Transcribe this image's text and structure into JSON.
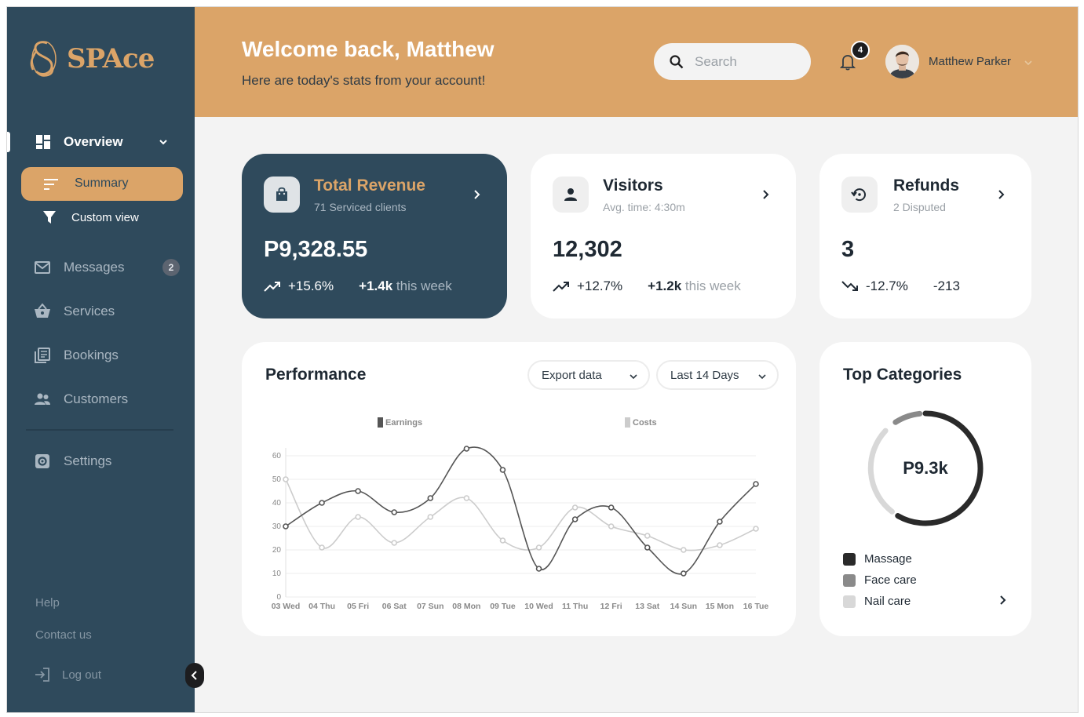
{
  "brand": {
    "name": "SPAce",
    "accent": "#dba468",
    "sidebar_bg": "#2f4a5c"
  },
  "sidebar": {
    "overview": {
      "label": "Overview",
      "icon": "dashboard-icon"
    },
    "summary": {
      "label": "Summary",
      "icon": "sort-lines-icon"
    },
    "custom_view": {
      "label": "Custom view",
      "icon": "filter-icon"
    },
    "items": [
      {
        "label": "Messages",
        "icon": "mail-icon",
        "badge": "2"
      },
      {
        "label": "Services",
        "icon": "basket-icon"
      },
      {
        "label": "Bookings",
        "icon": "library-books-icon"
      },
      {
        "label": "Customers",
        "icon": "people-icon"
      },
      {
        "label": "Settings",
        "icon": "settings-gear-icon"
      }
    ],
    "help": "Help",
    "contact": "Contact us",
    "logout": "Log out"
  },
  "header": {
    "welcome": "Welcome back, Matthew",
    "subtitle": "Here are today's stats from your account!",
    "search_placeholder": "Search",
    "notifications": "4",
    "user_name": "Matthew Parker"
  },
  "stats": [
    {
      "title": "Total Revenue",
      "subtitle": "71 Serviced clients",
      "value": "P9,328.55",
      "trend": "+15.6%",
      "week_value": "+1.4k",
      "week_label": "this week",
      "direction": "up"
    },
    {
      "title": "Visitors",
      "subtitle": "Avg. time: 4:30m",
      "value": "12,302",
      "trend": "+12.7%",
      "week_value": "+1.2k",
      "week_label": "this week",
      "direction": "up"
    },
    {
      "title": "Refunds",
      "subtitle": "2 Disputed",
      "value": "3",
      "trend": "-12.7%",
      "week_value": "-213",
      "week_label": "",
      "direction": "down"
    }
  ],
  "performance": {
    "title": "Performance",
    "export_label": "Export data",
    "range_label": "Last 14 Days"
  },
  "chart_data": {
    "type": "line",
    "x": [
      "03 Wed",
      "04 Thu",
      "05 Fri",
      "06 Sat",
      "07 Sun",
      "08 Mon",
      "09 Tue",
      "10 Wed",
      "11 Thu",
      "12 Fri",
      "13 Sat",
      "14 Sun",
      "15 Mon",
      "16 Tue"
    ],
    "series": [
      {
        "name": "Earnings",
        "color": "#555555",
        "values": [
          30,
          40,
          45,
          36,
          42,
          63,
          54,
          12,
          33,
          38,
          21,
          10,
          32,
          48
        ]
      },
      {
        "name": "Costs",
        "color": "#cccccc",
        "values": [
          50,
          21,
          34,
          23,
          34,
          42,
          24,
          21,
          38,
          30,
          26,
          20,
          22,
          29
        ]
      }
    ],
    "yticks": [
      0,
      10,
      20,
      30,
      40,
      50,
      60
    ],
    "ylim": [
      0,
      60
    ],
    "grid": true,
    "legend_position": "top"
  },
  "categories": {
    "title": "Top Categories",
    "total": "P9.3k",
    "items": [
      {
        "label": "Massage",
        "color": "#2a2a2a"
      },
      {
        "label": "Face care",
        "color": "#8a8a8a"
      },
      {
        "label": "Nail care",
        "color": "#d8d8d8"
      }
    ]
  }
}
